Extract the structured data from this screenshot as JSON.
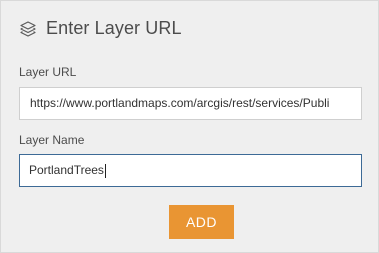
{
  "dialog": {
    "title": "Enter Layer URL",
    "header_icon": "layers-icon"
  },
  "form": {
    "url_label": "Layer URL",
    "url_value": "https://www.portlandmaps.com/arcgis/rest/services/Publi",
    "name_label": "Layer Name",
    "name_value": "PortlandTrees",
    "add_label": "ADD"
  },
  "colors": {
    "accent": "#e99533",
    "focus_border": "#3d6a96",
    "panel_background": "#efefef"
  }
}
